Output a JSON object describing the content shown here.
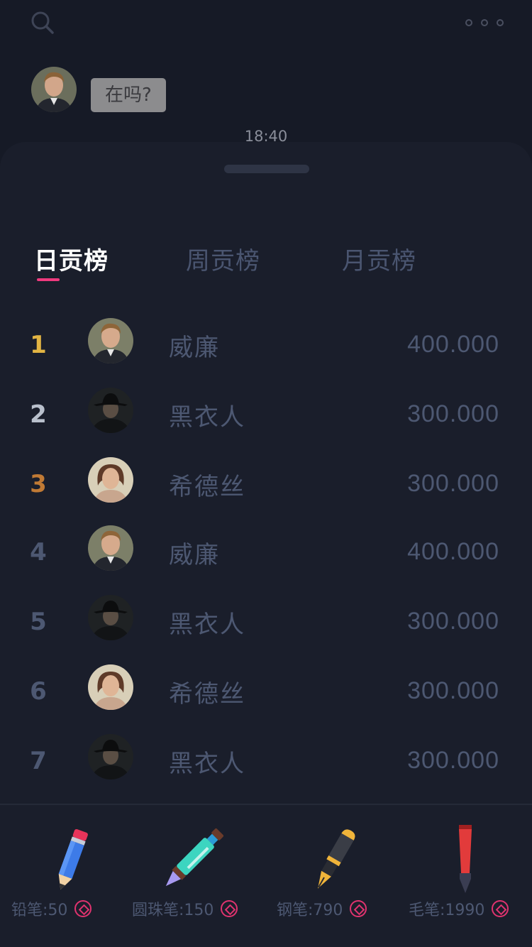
{
  "chat": {
    "message": "在吗?",
    "time": "18:40"
  },
  "tabs": [
    {
      "label": "日贡榜",
      "active": true
    },
    {
      "label": "周贡榜",
      "active": false
    },
    {
      "label": "月贡榜",
      "active": false
    }
  ],
  "leaderboard": [
    {
      "rank": "1",
      "name": "威廉",
      "score": "400.000",
      "avatar": "man-blond"
    },
    {
      "rank": "2",
      "name": "黑衣人",
      "score": "300.000",
      "avatar": "man-in-black"
    },
    {
      "rank": "3",
      "name": "希德丝",
      "score": "300.000",
      "avatar": "woman"
    },
    {
      "rank": "4",
      "name": "威廉",
      "score": "400.000",
      "avatar": "man-blond"
    },
    {
      "rank": "5",
      "name": "黑衣人",
      "score": "300.000",
      "avatar": "man-in-black"
    },
    {
      "rank": "6",
      "name": "希德丝",
      "score": "300.000",
      "avatar": "woman"
    },
    {
      "rank": "7",
      "name": "黑衣人",
      "score": "300.000",
      "avatar": "man-in-black"
    }
  ],
  "gifts": [
    {
      "label": "铅笔:50",
      "icon": "pencil-icon"
    },
    {
      "label": "圆珠笔:150",
      "icon": "ballpoint-pen-icon"
    },
    {
      "label": "钢笔:790",
      "icon": "fountain-pen-icon"
    },
    {
      "label": "毛笔:1990",
      "icon": "brush-pen-icon"
    }
  ],
  "colors": {
    "background": "#161a26",
    "sheet": "#1a1e2b",
    "accent": "#ef3a7e",
    "rank_gold": "#e2b443",
    "rank_silver": "#b9c0cc",
    "rank_bronze": "#c07a35",
    "muted_text": "#4d5872"
  }
}
